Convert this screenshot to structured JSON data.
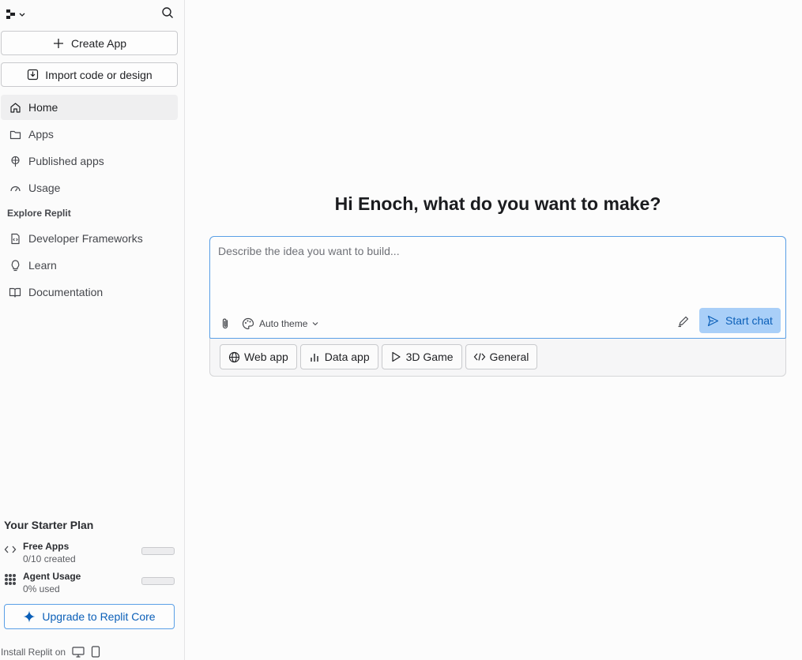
{
  "sidebar": {
    "create_app": "Create App",
    "import": "Import code or design",
    "nav": [
      {
        "label": "Home",
        "icon": "home-icon"
      },
      {
        "label": "Apps",
        "icon": "folder-icon"
      },
      {
        "label": "Published apps",
        "icon": "globe-pin-icon"
      },
      {
        "label": "Usage",
        "icon": "gauge-icon"
      }
    ],
    "explore_label": "Explore Replit",
    "explore": [
      {
        "label": "Developer Frameworks",
        "icon": "code-file-icon"
      },
      {
        "label": "Learn",
        "icon": "lightbulb-icon"
      },
      {
        "label": "Documentation",
        "icon": "book-icon"
      }
    ],
    "plan": {
      "title": "Your Starter Plan",
      "free_apps": {
        "label": "Free Apps",
        "detail": "0/10 created",
        "fraction": 0
      },
      "agent_usage": {
        "label": "Agent Usage",
        "detail": "0% used",
        "fraction": 0
      }
    },
    "upgrade": "Upgrade to Replit Core",
    "install": "Install Replit on"
  },
  "main": {
    "headline": "Hi Enoch, what do you want to make?",
    "placeholder": "Describe the idea you want to build...",
    "theme": "Auto theme",
    "start_chat": "Start chat",
    "chips": [
      {
        "label": "Web app",
        "icon": "globe-icon"
      },
      {
        "label": "Data app",
        "icon": "bar-chart-icon"
      },
      {
        "label": "3D Game",
        "icon": "play-icon"
      },
      {
        "label": "General",
        "icon": "code-icon"
      }
    ]
  },
  "colors": {
    "accent": "#0079f2",
    "accent_light": "#a9cff8",
    "border_focus": "#5a9fe6"
  }
}
